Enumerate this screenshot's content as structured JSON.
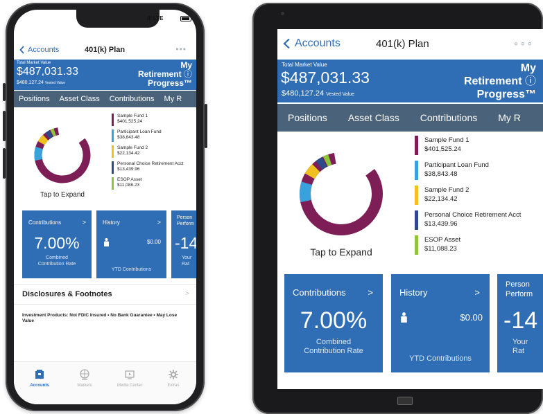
{
  "phone": {
    "status": {
      "signal": "ıll LTE",
      "battery": "battery-icon"
    },
    "nav": {
      "back": "Accounts",
      "title": "401(k) Plan",
      "more": "•••"
    },
    "header": {
      "tmv_label": "Total Market Value",
      "tmv_value": "$487,031.33",
      "vested_value": "$480,127.24",
      "vested_label": "Vested Value",
      "progress_line1": "My",
      "progress_line2": "Retirement",
      "progress_line3": "Progress™",
      "info_icon": "ⓘ"
    },
    "tabs": [
      "Positions",
      "Asset Class",
      "Contributions",
      "My R"
    ],
    "tap_expand": "Tap to Expand",
    "card1": {
      "title": "Contributions",
      "chevron": ">",
      "value": "7.00%",
      "sub1": "Combined",
      "sub2": "Contribution Rate"
    },
    "card2": {
      "title": "History",
      "chevron": ">",
      "amount": "$0.00",
      "sub": "YTD Contributions"
    },
    "card3": {
      "title1": "Person",
      "title2": "Perform",
      "value": "-14",
      "sub1": "Your",
      "sub2": "Rat"
    },
    "disclosures": {
      "label": "Disclosures & Footnotes",
      "chevron": ">"
    },
    "investment_note": "Investment Products: Not FDIC Insured • No Bank Guarantee • May Lose Value",
    "bottom_nav": [
      {
        "label": "Accounts",
        "icon": "accounts-icon",
        "active": true
      },
      {
        "label": "Markets",
        "icon": "markets-icon",
        "active": false
      },
      {
        "label": "Media Center",
        "icon": "media-center-icon",
        "active": false
      },
      {
        "label": "Extras",
        "icon": "extras-icon",
        "active": false
      }
    ]
  },
  "tablet": {
    "nav": {
      "back": "Accounts",
      "title": "401(k) Plan",
      "more": "∘∘∘"
    },
    "header": {
      "tmv_label": "Total Market Value",
      "tmv_value": "$487,031.33",
      "vested_value": "$480,127.24",
      "vested_label": "Vested Value",
      "progress_line1": "My",
      "progress_line2": "Retirement",
      "progress_line3": "Progress™",
      "info_icon": "ⓘ"
    },
    "tabs": [
      "Positions",
      "Asset Class",
      "Contributions",
      "My R"
    ],
    "tap_expand": "Tap to Expand",
    "card1": {
      "title": "Contributions",
      "chevron": ">",
      "value": "7.00%",
      "sub1": "Combined",
      "sub2": "Contribution Rate"
    },
    "card2": {
      "title": "History",
      "chevron": ">",
      "amount": "$0.00",
      "sub": "YTD Contributions"
    },
    "card3": {
      "title1": "Person",
      "title2": "Perform",
      "value": "-14",
      "sub1": "Your",
      "sub2": "Rat"
    }
  },
  "funds": [
    {
      "name": "Sample Fund 1",
      "value": "$401,525.24",
      "amount": 401525.24,
      "color": "#7d1f56"
    },
    {
      "name": "Participant Loan Fund",
      "value": "$38,843.48",
      "amount": 38843.48,
      "color": "#39a1dc"
    },
    {
      "name": "Sample Fund 2",
      "value": "$22,134.42",
      "amount": 22134.42,
      "color": "#f0c020"
    },
    {
      "name": "Personal Choice Retirement Acct",
      "value": "$13,439.96",
      "amount": 13439.96,
      "color": "#2c4a8a"
    },
    {
      "name": "ESOP Asset",
      "value": "$11,088.23",
      "amount": 11088.23,
      "color": "#8cc43c"
    }
  ],
  "colors": {
    "blue": "#2f6db5",
    "tab_bar": "#4a637a",
    "link": "#2f6db5"
  }
}
